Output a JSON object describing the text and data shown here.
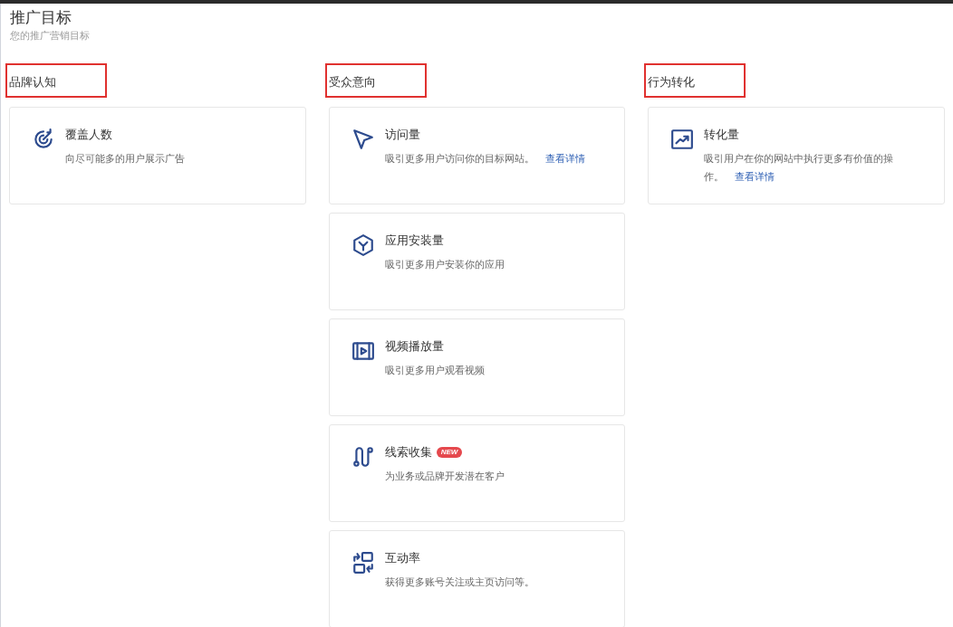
{
  "header": {
    "title": "推广目标",
    "subtitle": "您的推广营销目标"
  },
  "columns": [
    {
      "heading": "品牌认知",
      "highlighted": true,
      "cards": [
        {
          "kind": "target",
          "title": "覆盖人数",
          "description": "向尽可能多的用户展示广告"
        }
      ]
    },
    {
      "heading": "受众意向",
      "highlighted": true,
      "cards": [
        {
          "kind": "cursor",
          "title": "访问量",
          "description": "吸引更多用户访问你的目标网站。",
          "link": "查看详情"
        },
        {
          "kind": "hexagon",
          "title": "应用安装量",
          "description": "吸引更多用户安装你的应用"
        },
        {
          "kind": "film",
          "title": "视频播放量",
          "description": "吸引更多用户观看视频"
        },
        {
          "kind": "route",
          "title": "线索收集",
          "badge": "NEW",
          "description": "为业务或品牌开发潜在客户"
        },
        {
          "kind": "swap",
          "title": "互动率",
          "description": "获得更多账号关注或主页访问等。"
        }
      ]
    },
    {
      "heading": "行为转化",
      "highlighted": true,
      "cards": [
        {
          "kind": "chart",
          "title": "转化量",
          "description": "吸引用户在你的网站中执行更多有价值的操作。",
          "link": "查看详情"
        }
      ]
    }
  ]
}
